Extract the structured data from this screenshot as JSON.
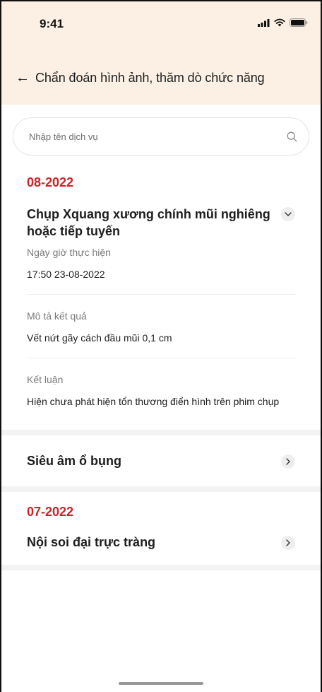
{
  "status_bar": {
    "time": "9:41"
  },
  "header": {
    "title": "Chẩn đoán hình ảnh, thăm dò chức năng"
  },
  "search": {
    "placeholder": "Nhập tên dịch vụ"
  },
  "groups": [
    {
      "month": "08-2022",
      "expanded_item": {
        "title": "Chụp Xquang xương chính mũi nghiêng hoặc tiếp tuyến",
        "details": [
          {
            "label": "Ngày giờ thực hiện",
            "value": "17:50 23-08-2022"
          },
          {
            "label": "Mô tả kết quả",
            "value": "Vết nứt gãy cách đầu mũi 0,1 cm"
          },
          {
            "label": "Kết luận",
            "value": "Hiện chưa phát hiện tổn thương điển hình trên phim chụp"
          }
        ]
      },
      "collapsed_items": [
        {
          "title": "Siêu âm ổ bụng"
        }
      ]
    },
    {
      "month": "07-2022",
      "collapsed_items": [
        {
          "title": "Nội soi đại trực tràng"
        }
      ]
    }
  ],
  "colors": {
    "accent": "#d0212a",
    "header_bg": "#fbf0e3",
    "separator": "#f3f3f3"
  },
  "icons": [
    "signal-icon",
    "wifi-icon",
    "battery-icon",
    "back-arrow-icon",
    "search-icon",
    "chevron-down-icon",
    "chevron-right-icon"
  ]
}
